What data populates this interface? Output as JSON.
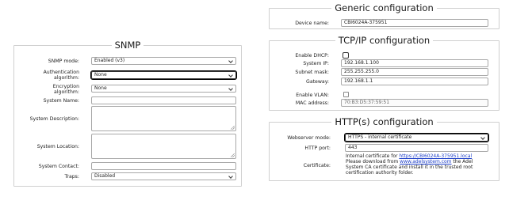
{
  "snmp": {
    "title": "SNMP",
    "mode_label": "SNMP mode:",
    "mode_value": "Enabled (v3)",
    "auth_label_1": "Authentication",
    "auth_label_2": "algorithm:",
    "auth_value": "None",
    "enc_label_1": "Encryption",
    "enc_label_2": "algorithm:",
    "enc_value": "None",
    "system_name_label": "System Name:",
    "system_name_value": "",
    "system_description_label": "System Description:",
    "system_location_label": "System Location:",
    "system_contact_label": "System Contact:",
    "system_contact_value": "",
    "traps_label": "Traps:",
    "traps_value": "Disabled"
  },
  "generic": {
    "title": "Generic configuration",
    "device_name_label": "Device name:",
    "device_name_value": "CBI6024A-375951"
  },
  "tcpip": {
    "title": "TCP/IP configuration",
    "dhcp_label": "Enable DHCP:",
    "dhcp_checked": false,
    "ip_label": "System IP:",
    "ip_value": "192.168.1.100",
    "mask_label": "Subnet mask:",
    "mask_value": "255.255.255.0",
    "gateway_label": "Gateway:",
    "gateway_value": "192.168.1.1",
    "vlan_label": "Enable VLAN:",
    "vlan_checked": false,
    "mac_label": "MAC address:",
    "mac_value": "70:B3:D5:37:59:51"
  },
  "http": {
    "title": "HTTP(s) configuration",
    "mode_label": "Webserver mode:",
    "mode_value": "HTTPS - internal certificate",
    "port_label": "HTTP port:",
    "port_value": "443",
    "cert_label": "Certificate:",
    "cert_text_1": "Internal certificate for ",
    "cert_link_1": "https://CBI6024A-375951.local",
    "cert_text_2": "Please download from ",
    "cert_link_2": "www.adelsystem.com",
    "cert_text_3": " the Adel",
    "cert_text_4": "System CA certificate and install it in the trusted root",
    "cert_text_5": "certification authority folder."
  }
}
